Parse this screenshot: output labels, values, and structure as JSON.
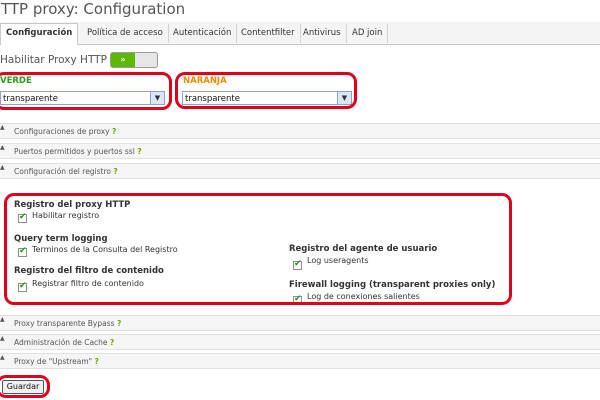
{
  "header": {
    "title": "TTP proxy: Configuration"
  },
  "tabs": [
    {
      "label": "Configuración",
      "active": true
    },
    {
      "label": "Política de acceso"
    },
    {
      "label": "Autenticación"
    },
    {
      "label": "Contentfilter"
    },
    {
      "label": "Antivirus"
    },
    {
      "label": "AD join"
    }
  ],
  "enable": {
    "label": "Habilitar Proxy HTTP",
    "toggle_symbol": "»"
  },
  "zones": {
    "green": {
      "label": "VERDE",
      "value": "transparente",
      "color": "#2e9b1f"
    },
    "orange": {
      "label": "NARANJA",
      "value": "transparente",
      "color": "#f08a00"
    }
  },
  "sections": [
    {
      "label": "Configuraciones de proxy",
      "help": "?"
    },
    {
      "label": "Puertos permitidos y puertos ssl",
      "help": "?"
    },
    {
      "label": "Configuración del registro",
      "help": "?"
    },
    {
      "label": "Proxy transparente Bypass",
      "help": "?"
    },
    {
      "label": "Administración de Cache",
      "help": "?"
    },
    {
      "label": "Proxy de \"Upstream\"",
      "help": "?"
    }
  ],
  "logging": {
    "proxy_log": {
      "title": "Registro del proxy HTTP",
      "option": "Habilitar registro",
      "checked": true
    },
    "query_term": {
      "title": "Query term logging",
      "option": "Terminos de la Consulta del Registro",
      "checked": true
    },
    "content_filter": {
      "title": "Registro del filtro de contenido",
      "option": "Registrar filtro de contenido",
      "checked": true
    },
    "user_agent": {
      "title": "Registro del agente de usuario",
      "option": "Log useragents",
      "checked": true
    },
    "firewall": {
      "title": "Firewall logging (transparent proxies only)",
      "option": "Log de conexiones salientes",
      "checked": true
    }
  },
  "actions": {
    "save_label": "Guardar"
  },
  "colors": {
    "accent": "#5cb800",
    "highlight": "#e0001b",
    "check": "#2a8f1f"
  }
}
